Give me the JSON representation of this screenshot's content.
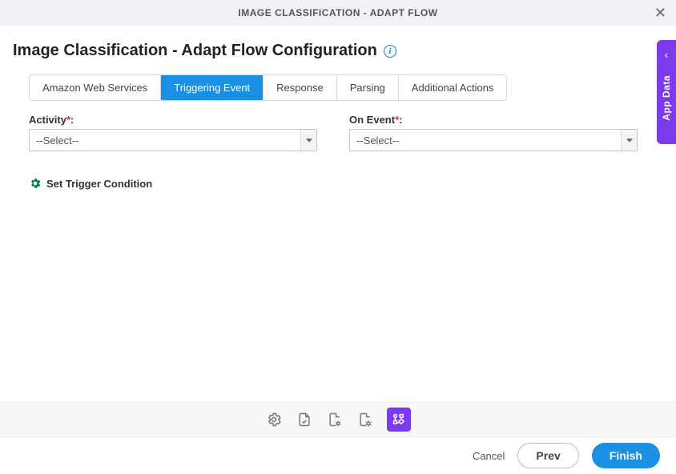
{
  "header": {
    "title": "IMAGE CLASSIFICATION - ADAPT FLOW"
  },
  "page": {
    "title": "Image Classification - Adapt Flow Configuration"
  },
  "tabs": [
    {
      "label": "Amazon Web Services",
      "active": false
    },
    {
      "label": "Triggering Event",
      "active": true
    },
    {
      "label": "Response",
      "active": false
    },
    {
      "label": "Parsing",
      "active": false
    },
    {
      "label": "Additional Actions",
      "active": false
    }
  ],
  "form": {
    "activity": {
      "label": "Activity",
      "required": ":",
      "placeholder": "--Select--"
    },
    "onEvent": {
      "label": "On Event",
      "required": ":",
      "placeholder": "--Select--"
    }
  },
  "trigger": {
    "label": "Set Trigger Condition"
  },
  "footer": {
    "cancel": "Cancel",
    "prev": "Prev",
    "finish": "Finish"
  },
  "sidePanel": {
    "label": "App Data"
  }
}
